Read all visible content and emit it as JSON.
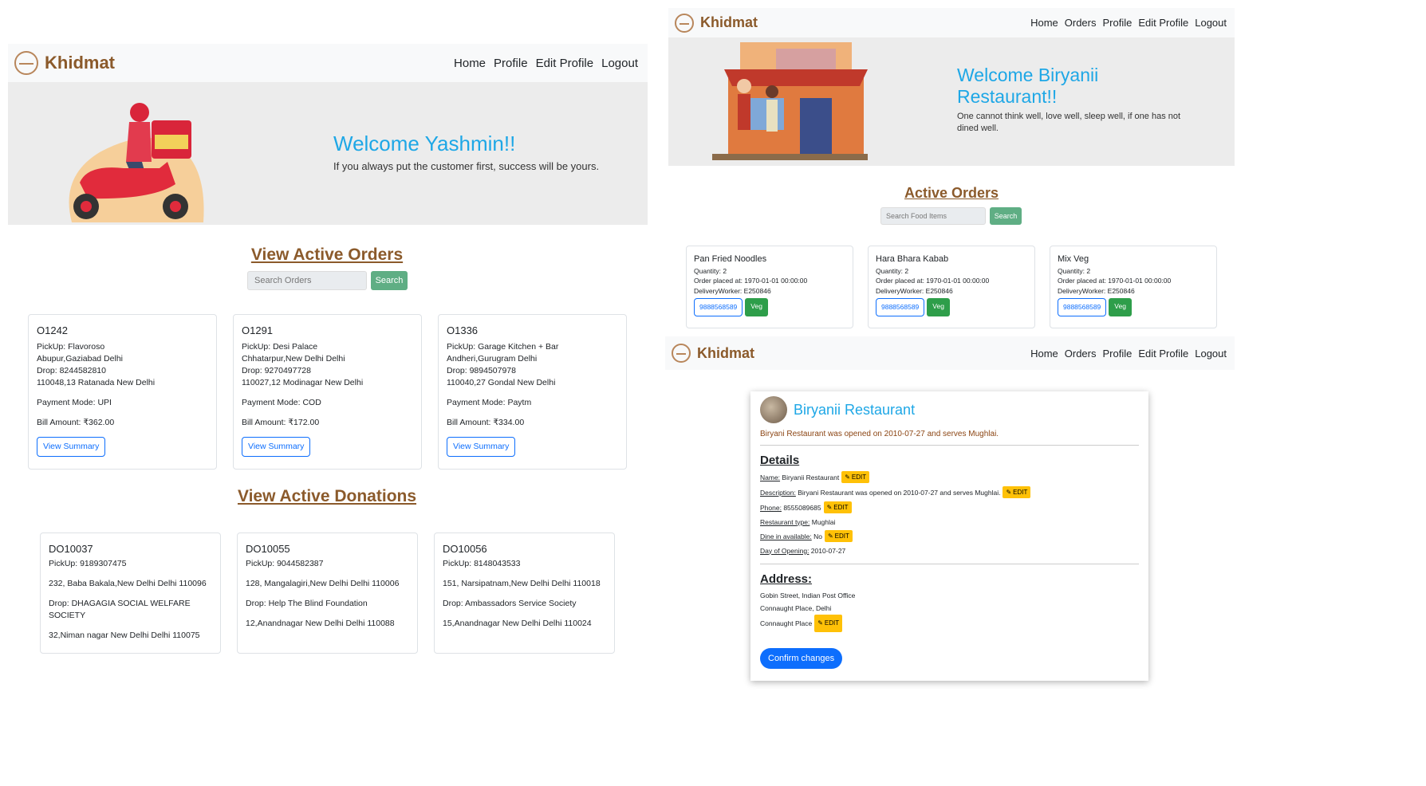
{
  "courier": {
    "brand": "Khidmat",
    "nav": [
      "Home",
      "Profile",
      "Edit Profile",
      "Logout"
    ],
    "welcome": "Welcome Yashmin!!",
    "tagline": "If you always put the customer first, success will be yours.",
    "orders_heading": "View Active Orders",
    "search_placeholder": "Search Orders",
    "search_button": "Search",
    "orders": [
      {
        "id": "O1242",
        "pickup": "PickUp: Flavoroso",
        "pickup_addr": "Abupur,Gaziabad Delhi",
        "drop": "Drop: 8244582810",
        "drop_addr": "110048,13 Ratanada New Delhi",
        "payment": "Payment Mode: UPI",
        "bill": "Bill Amount: ₹362.00",
        "button": "View Summary"
      },
      {
        "id": "O1291",
        "pickup": "PickUp: Desi Palace",
        "pickup_addr": "Chhatarpur,New Delhi Delhi",
        "drop": "Drop: 9270497728",
        "drop_addr": "110027,12 Modinagar New Delhi",
        "payment": "Payment Mode: COD",
        "bill": "Bill Amount: ₹172.00",
        "button": "View Summary"
      },
      {
        "id": "O1336",
        "pickup": "PickUp: Garage Kitchen + Bar",
        "pickup_addr": "Andheri,Gurugram Delhi",
        "drop": "Drop: 9894507978",
        "drop_addr": "110040,27 Gondal New Delhi",
        "payment": "Payment Mode: Paytm",
        "bill": "Bill Amount: ₹334.00",
        "button": "View Summary"
      }
    ],
    "donations_heading": "View Active Donations",
    "donations": [
      {
        "id": "DO10037",
        "pickup": "PickUp: 9189307475",
        "pickup_addr": "232, Baba Bakala,New Delhi Delhi 110096",
        "drop": "Drop: DHAGAGIA SOCIAL WELFARE SOCIETY",
        "drop_addr": "32,Niman nagar New Delhi Delhi 110075"
      },
      {
        "id": "DO10055",
        "pickup": "PickUp: 9044582387",
        "pickup_addr": "128, Mangalagiri,New Delhi Delhi 110006",
        "drop": "Drop: Help The Blind Foundation",
        "drop_addr": "12,Anandnagar New Delhi Delhi 110088"
      },
      {
        "id": "DO10056",
        "pickup": "PickUp: 8148043533",
        "pickup_addr": "151, Narsipatnam,New Delhi Delhi 110018",
        "drop": "Drop: Ambassadors Service Society",
        "drop_addr": "15,Anandnagar New Delhi Delhi 110024"
      }
    ]
  },
  "restaurant": {
    "brand": "Khidmat",
    "nav": [
      "Home",
      "Orders",
      "Profile",
      "Edit Profile",
      "Logout"
    ],
    "welcome": "Welcome Biryanii Restaurant!!",
    "tagline": "One cannot think well, love well, sleep well, if one has not dined well.",
    "orders_heading": "Active Orders",
    "search_placeholder": "Search Food Items",
    "search_button": "Search",
    "orders": [
      {
        "name": "Pan Fried Noodles",
        "qty": "Quantity: 2",
        "placed": "Order placed at: 1970-01-01 00:00:00",
        "worker": "DeliveryWorker: E250846",
        "phone": "9888568589",
        "tag": "Veg"
      },
      {
        "name": "Hara Bhara Kabab",
        "qty": "Quantity: 2",
        "placed": "Order placed at: 1970-01-01 00:00:00",
        "worker": "DeliveryWorker: E250846",
        "phone": "9888568589",
        "tag": "Veg"
      },
      {
        "name": "Mix Veg",
        "qty": "Quantity: 2",
        "placed": "Order placed at: 1970-01-01 00:00:00",
        "worker": "DeliveryWorker: E250846",
        "phone": "9888568589",
        "tag": "Veg"
      }
    ]
  },
  "profile": {
    "brand": "Khidmat",
    "nav": [
      "Home",
      "Orders",
      "Profile",
      "Edit Profile",
      "Logout"
    ],
    "name": "Biryanii Restaurant",
    "subtitle": "Biryani Restaurant was opened on 2010-07-27 and serves Mughlai.",
    "details_heading": "Details",
    "details": [
      {
        "label": "Name:",
        "value": " Biryanii Restaurant",
        "edit": "EDIT"
      },
      {
        "label": "Description:",
        "value": " Biryani Restaurant was opened on 2010-07-27 and serves Mughlai.",
        "edit": "EDIT"
      },
      {
        "label": "Phone:",
        "value": " 8555089685",
        "edit": "EDIT"
      },
      {
        "label": "Restaurant type:",
        "value": " Mughlai",
        "edit": ""
      },
      {
        "label": "Dine in available:",
        "value": " No",
        "edit": "EDIT"
      },
      {
        "label": "Day of Opening:",
        "value": " 2010-07-27",
        "edit": ""
      }
    ],
    "address_heading": "Address:",
    "address_lines": [
      "Gobin Street, Indian Post Office",
      "Connaught Place, Delhi",
      "Connaught Place"
    ],
    "address_edit": "EDIT",
    "confirm_button": "Confirm changes"
  },
  "colors": {
    "brand": "#8b5a2b",
    "accent_blue": "#1ea7e6",
    "edit_yellow": "#ffc107",
    "search_green": "#5fae84",
    "veg_green": "#2e9e4a",
    "primary": "#0d6efd"
  }
}
